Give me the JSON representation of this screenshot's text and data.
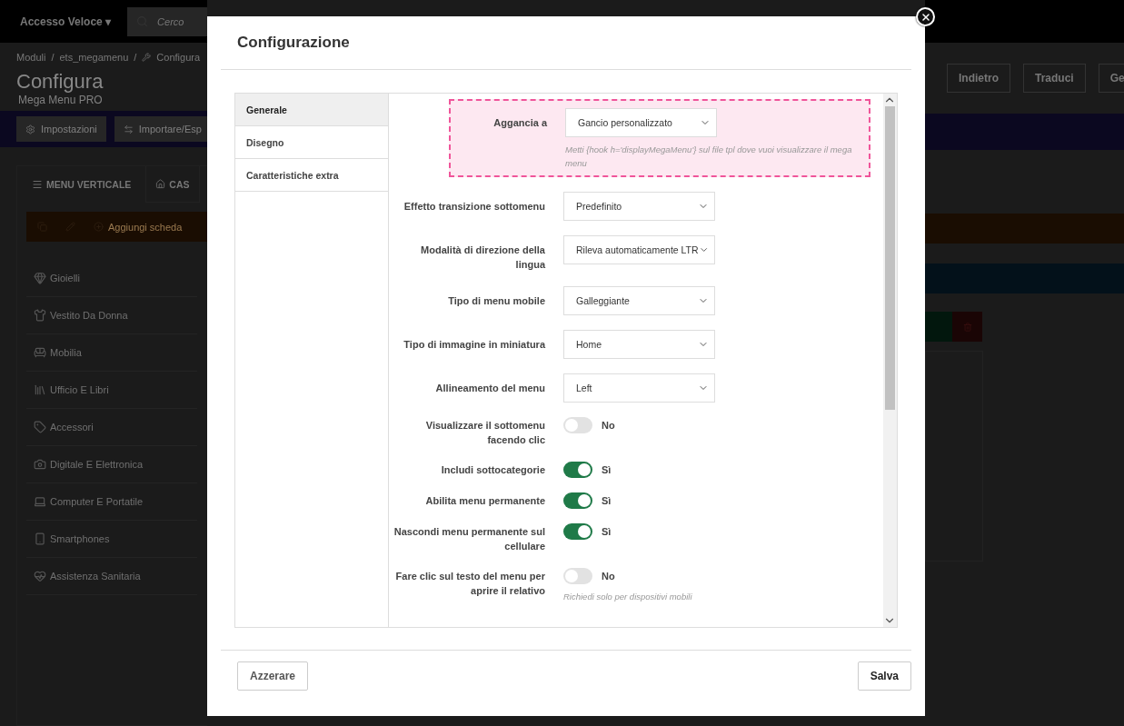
{
  "background_page": {
    "quick_access": "Accesso Veloce",
    "quick_access_caret": "▾",
    "search": {
      "placeholder": "Cerco"
    },
    "breadcrumb": {
      "separator": "/",
      "items": [
        "Moduli",
        "ets_megamenu",
        "Configura"
      ]
    },
    "title": "Configura",
    "subtitle": "Mega Menu PRO",
    "nav_buttons": [
      "Impostazioni",
      "Importare/Esp"
    ],
    "toolbar_buttons": [
      "Indietro",
      "Traduci",
      "Ge"
    ],
    "menu_tabs": [
      "MENU VERTICALE",
      "CAS"
    ],
    "add_tab": "Aggiungi scheda",
    "menu_items": [
      "Gioielli",
      "Vestito Da Donna",
      "Mobilia",
      "Ufficio E Libri",
      "Accessori",
      "Digitale E Elettronica",
      "Computer E Portatile",
      "Smartphones",
      "Assistenza Sanitaria"
    ]
  },
  "dialog": {
    "title": "Configurazione",
    "tabs": [
      {
        "label": "Generale",
        "selected": true
      },
      {
        "label": "Disegno",
        "selected": false
      },
      {
        "label": "Caratteristiche extra",
        "selected": false
      }
    ],
    "fields": [
      {
        "kind": "select",
        "label": "Aggancia a",
        "value": "Gancio personalizzato",
        "highlighted": true,
        "help": "Metti {hook h='displayMegaMenu'} sul file tpl dove vuoi visualizzare il mega menu"
      },
      {
        "kind": "select",
        "label": "Effetto transizione sottomenu",
        "value": "Predefinito",
        "highlighted": false
      },
      {
        "kind": "select",
        "label": "Modalità di direzione della lingua",
        "value": "Rileva automaticamente LTR",
        "highlighted": false
      },
      {
        "kind": "select",
        "label": "Tipo di menu mobile",
        "value": "Galleggiante",
        "highlighted": false
      },
      {
        "kind": "select",
        "label": "Tipo di immagine in miniatura",
        "value": "Home",
        "highlighted": false
      },
      {
        "kind": "select",
        "label": "Allineamento del menu",
        "value": "Left",
        "highlighted": false
      },
      {
        "kind": "toggle",
        "label": "Visualizzare il sottomenu facendo clic",
        "on": false,
        "state_text": "No",
        "highlighted": false
      },
      {
        "kind": "toggle",
        "label": "Includi sottocategorie",
        "on": true,
        "state_text": "Sì",
        "highlighted": false
      },
      {
        "kind": "toggle",
        "label": "Abilita menu permanente",
        "on": true,
        "state_text": "Sì",
        "highlighted": false
      },
      {
        "kind": "toggle",
        "label": "Nascondi menu permanente sul cellulare",
        "on": true,
        "state_text": "Sì",
        "highlighted": false
      },
      {
        "kind": "toggle",
        "label": "Fare clic sul testo del menu per aprire il relativo",
        "on": false,
        "state_text": "No",
        "highlighted": false,
        "help": "Richiedi solo per dispositivi mobili"
      }
    ],
    "buttons": {
      "reset": "Azzerare",
      "save": "Salva"
    }
  }
}
